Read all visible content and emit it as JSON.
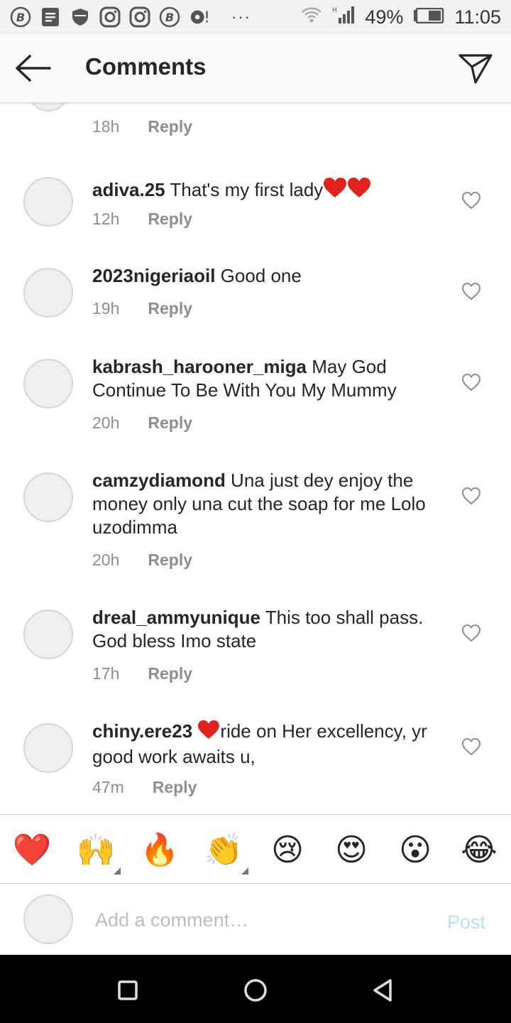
{
  "status_bar": {
    "battery": "49%",
    "time": "11:05",
    "overflow": "···",
    "icons": [
      "b-app-icon",
      "document-icon",
      "shield-icon",
      "instagram-icon",
      "instagram-icon",
      "b-app-icon",
      "pin-icon",
      "wifi-icon",
      "signal-icon",
      "battery-icon"
    ]
  },
  "header": {
    "title": "Comments"
  },
  "partial_comment": {
    "time": "18h",
    "reply": "Reply"
  },
  "comments": [
    {
      "username": "adiva.25",
      "text": " That's my first lady",
      "time": "12h",
      "reply": "Reply"
    },
    {
      "username": "2023nigeriaoil",
      "text": " Good one",
      "time": "19h",
      "reply": "Reply"
    },
    {
      "username": "kabrash_harooner_miga",
      "text": " May God Continue To Be With You My Mummy",
      "time": "20h",
      "reply": "Reply"
    },
    {
      "username": "camzydiamond",
      "text": " Una just dey enjoy the money only una cut the soap for me Lolo uzodimma",
      "time": "20h",
      "reply": "Reply"
    },
    {
      "username": "dreal_ammyunique",
      "text": " This too shall pass. God bless Imo state",
      "time": "17h",
      "reply": "Reply"
    },
    {
      "username": "chiny.ere23",
      "text": "ride on Her excellency, yr good work awaits u,",
      "time": "47m",
      "reply": "Reply"
    }
  ],
  "emoji_bar": [
    "❤️",
    "🙌",
    "🔥",
    "👏",
    "😢",
    "😍",
    "😮",
    "😂"
  ],
  "input": {
    "placeholder": "Add a comment…",
    "value": "",
    "post_label": "Post"
  },
  "colors": {
    "heart": "#e0231e",
    "post_disabled": "#b9dffc",
    "meta": "#8e8e8e"
  }
}
